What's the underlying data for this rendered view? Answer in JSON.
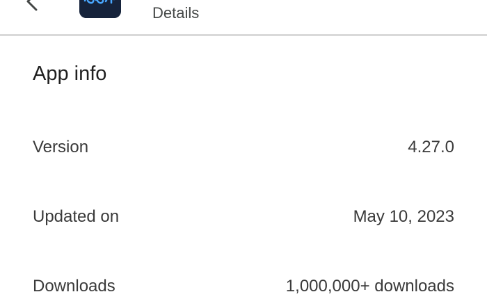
{
  "header": {
    "back_icon": "arrow-back-icon",
    "app_icon": "app-logo-icon",
    "subtitle": "Details"
  },
  "app_info": {
    "title": "App info",
    "rows": [
      {
        "label": "Version",
        "value": "4.27.0"
      },
      {
        "label": "Updated on",
        "value": "May 10, 2023"
      },
      {
        "label": "Downloads",
        "value": "1,000,000+ downloads"
      }
    ]
  },
  "colors": {
    "background": "#ffffff",
    "text_primary": "#1f1f1f",
    "text_secondary": "#444746",
    "divider": "#d9d9d9",
    "app_icon_bg": "#16233b",
    "app_icon_accent": "#4aa8ff"
  }
}
